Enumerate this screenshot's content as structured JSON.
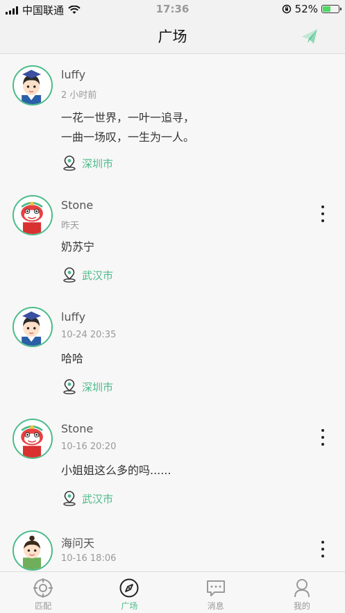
{
  "status_bar": {
    "carrier": "中国联通",
    "time": "17:36",
    "battery": "52%",
    "battery_level": 0.52
  },
  "header": {
    "title": "广场",
    "send_icon": "paper-plane-icon"
  },
  "posts": [
    {
      "username": "luffy",
      "time": "2 小时前",
      "content": "一花一世界，一叶一追寻，\n一曲一场叹，一生为一人。",
      "location": "深圳市",
      "avatar": "scholar-boy",
      "more": false
    },
    {
      "username": "Stone",
      "time": "昨天",
      "content": "奶苏宁",
      "location": "武汉市",
      "avatar": "lion-dance",
      "more": true
    },
    {
      "username": "luffy",
      "time": "10-24 20:35",
      "content": "哈哈",
      "location": "深圳市",
      "avatar": "scholar-boy",
      "more": false
    },
    {
      "username": "Stone",
      "time": "10-16 20:20",
      "content": "小姐姐这么多的吗......",
      "location": "武汉市",
      "avatar": "lion-dance",
      "more": true
    },
    {
      "username": "海问天",
      "time": "10-16 18:06",
      "content": "",
      "location": "",
      "avatar": "kid",
      "more": true
    }
  ],
  "tabs": [
    {
      "label": "匹配",
      "icon": "target-icon",
      "active": false
    },
    {
      "label": "广场",
      "icon": "compass-icon",
      "active": true
    },
    {
      "label": "消息",
      "icon": "message-icon",
      "active": false
    },
    {
      "label": "我的",
      "icon": "profile-icon",
      "active": false
    }
  ],
  "colors": {
    "accent": "#4cbb8a",
    "text": "#333333",
    "muted": "#999999"
  }
}
